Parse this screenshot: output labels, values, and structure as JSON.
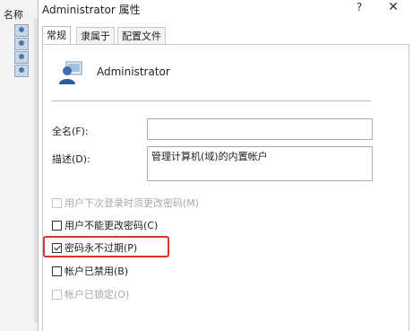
{
  "background_window": {
    "column_header": "名称",
    "icons": [
      "user-icon",
      "user-icon",
      "user-icon",
      "user-icon"
    ]
  },
  "dialog": {
    "title": "Administrator 属性",
    "help_glyph": "?",
    "close_glyph": "✕",
    "tabs": [
      {
        "label": "常规",
        "active": true
      },
      {
        "label": "隶属于",
        "active": false
      },
      {
        "label": "配置文件",
        "active": false
      }
    ],
    "general": {
      "user_name": "Administrator",
      "full_name_label": "全名(F):",
      "full_name_value": "",
      "description_label": "描述(D):",
      "description_value": "管理计算机(域)的内置帐户",
      "options": [
        {
          "label": "用户下次登录时须更改密码(M)",
          "checked": false,
          "disabled": true
        },
        {
          "label": "用户不能更改密码(C)",
          "checked": false,
          "disabled": false
        },
        {
          "label": "密码永不过期(P)",
          "checked": true,
          "disabled": false
        },
        {
          "label": "帐户已禁用(B)",
          "checked": false,
          "disabled": false
        },
        {
          "label": "帐户已锁定(O)",
          "checked": false,
          "disabled": true
        }
      ]
    }
  },
  "colors": {
    "highlight_border": "#d9372c",
    "disabled_text": "#a8a8a8"
  }
}
